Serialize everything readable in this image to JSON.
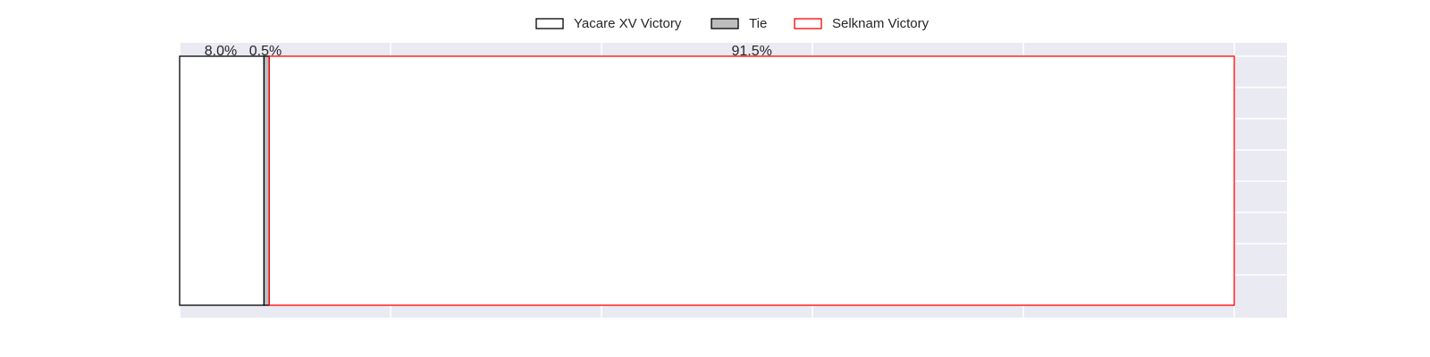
{
  "chart_data": {
    "type": "bar",
    "orientation": "horizontal",
    "stacked": true,
    "xlim": [
      0,
      105
    ],
    "grid": true,
    "legend": "top-center",
    "series": [
      {
        "name": "Yacare XV Victory",
        "value": 8.0,
        "label": "8.0%",
        "fill": "#ffffff",
        "stroke": "#000000"
      },
      {
        "name": "Tie",
        "value": 0.5,
        "label": "0.5%",
        "fill": "#bdbdbd",
        "stroke": "#000000"
      },
      {
        "name": "Selknam Victory",
        "value": 91.5,
        "label": "91.5%",
        "fill": "#ffffff",
        "stroke": "#ff0000"
      }
    ]
  }
}
